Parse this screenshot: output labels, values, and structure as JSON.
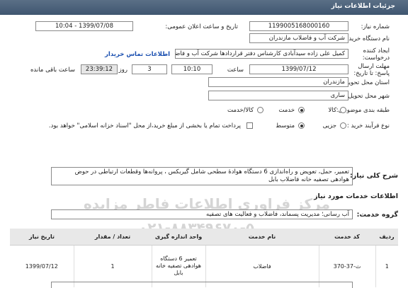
{
  "title": "جزئیات اطلاعات نیاز",
  "fields": {
    "need_number_label": "شماره نیاز:",
    "need_number": "1199005168000160",
    "announce_label": "تاریخ و ساعت اعلان عمومی:",
    "announce_value": "1399/07/08 - 10:04",
    "buyer_label": "نام دستگاه خریدار:",
    "buyer_value": "شرکت آب و فاضلاب مازندران",
    "requester_label": "ایجاد کننده درخواست:",
    "requester_value": "کمیل علی زاده سیدآبادی کارشناس دفتر قراردادها شرکت آب و فاضلاب مازندران",
    "contact_link": "اطلاعات تماس خریدار",
    "deadline_label": "مهلت ارسال پاسخ: تا تاریخ:",
    "deadline_date": "1399/07/12",
    "time_label": "ساعت",
    "deadline_time": "10:10",
    "days_value": "3",
    "days_label": "روز و",
    "countdown": "23:39:12",
    "remaining_label": "ساعت باقی مانده",
    "province_label": "استان محل تحویل:",
    "province_value": "مازندران",
    "city_label": "شهر محل تحویل:",
    "city_value": "ساری",
    "category_label": "طبقه بندی موضوعی:",
    "cat_goods": "کالا",
    "cat_service": "خدمت",
    "cat_both": "کالا/خدمت",
    "process_label": "نوع فرآیند خرید :",
    "proc_partial": "جزیی",
    "proc_medium": "متوسط",
    "payment_note": "پرداخت تمام یا بخشی از مبلغ خرید،از محل \"اسناد خزانه اسلامی\" خواهد بود."
  },
  "description_label": "شرح کلی نیاز:",
  "description": "تعمیر، حمل، تعویض و راه‌اندازی 6 دستگاه هوادهٔ سطحی شامل گیربکس ، پروانه‌ها وقطعات ارتباطی در حوض هوادهی تصفیه خانه فاضلاب  بابل",
  "services_header": "اطلاعات خدمات مورد نیاز",
  "service_group_label": "گروه خدمت:",
  "service_group_value": "آب رسانی؛ مدیریت پسماند، فاضلاب و فعالیت های تصفیه",
  "watermark": "مرکز فراوری اطلاعات فاطر مزایده",
  "watermark_phone": "۰۲۱-۸۸۳۴۹۶۷۰-۵",
  "table": {
    "headers": [
      "ردیف",
      "کد خدمت",
      "نام خدمت",
      "واحد اندازه گیری",
      "تعداد / مقدار",
      "تاریخ نیاز"
    ],
    "rows": [
      [
        "1",
        "ث-37-370",
        "فاضلاب",
        "تعمیر 6 دستگاه هوادهی تصفیه خانه بابل",
        "1",
        "1399/07/12"
      ]
    ]
  }
}
